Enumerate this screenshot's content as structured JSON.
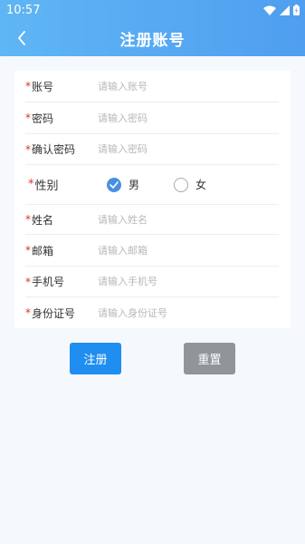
{
  "status": {
    "time": "10:57"
  },
  "header": {
    "title": "注册账号"
  },
  "form": {
    "fields": [
      {
        "label": "账号",
        "placeholder": "请输入账号"
      },
      {
        "label": "密码",
        "placeholder": "请输入密码"
      },
      {
        "label": "确认密码",
        "placeholder": "请输入密码"
      },
      {
        "label": "性别"
      },
      {
        "label": "姓名",
        "placeholder": "请输入姓名"
      },
      {
        "label": "邮箱",
        "placeholder": "请输入邮箱"
      },
      {
        "label": "手机号",
        "placeholder": "请输入手机号"
      },
      {
        "label": "身份证号",
        "placeholder": "请输入身份证号"
      }
    ],
    "gender_options": [
      "男",
      "女"
    ],
    "gender_selected": "男",
    "required_mark": "*"
  },
  "buttons": {
    "register": "注册",
    "reset": "重置"
  },
  "colors": {
    "header": "#5aa9f2",
    "primary": "#1f8ef0",
    "secondary": "#8f9599",
    "required": "#e0302a"
  }
}
